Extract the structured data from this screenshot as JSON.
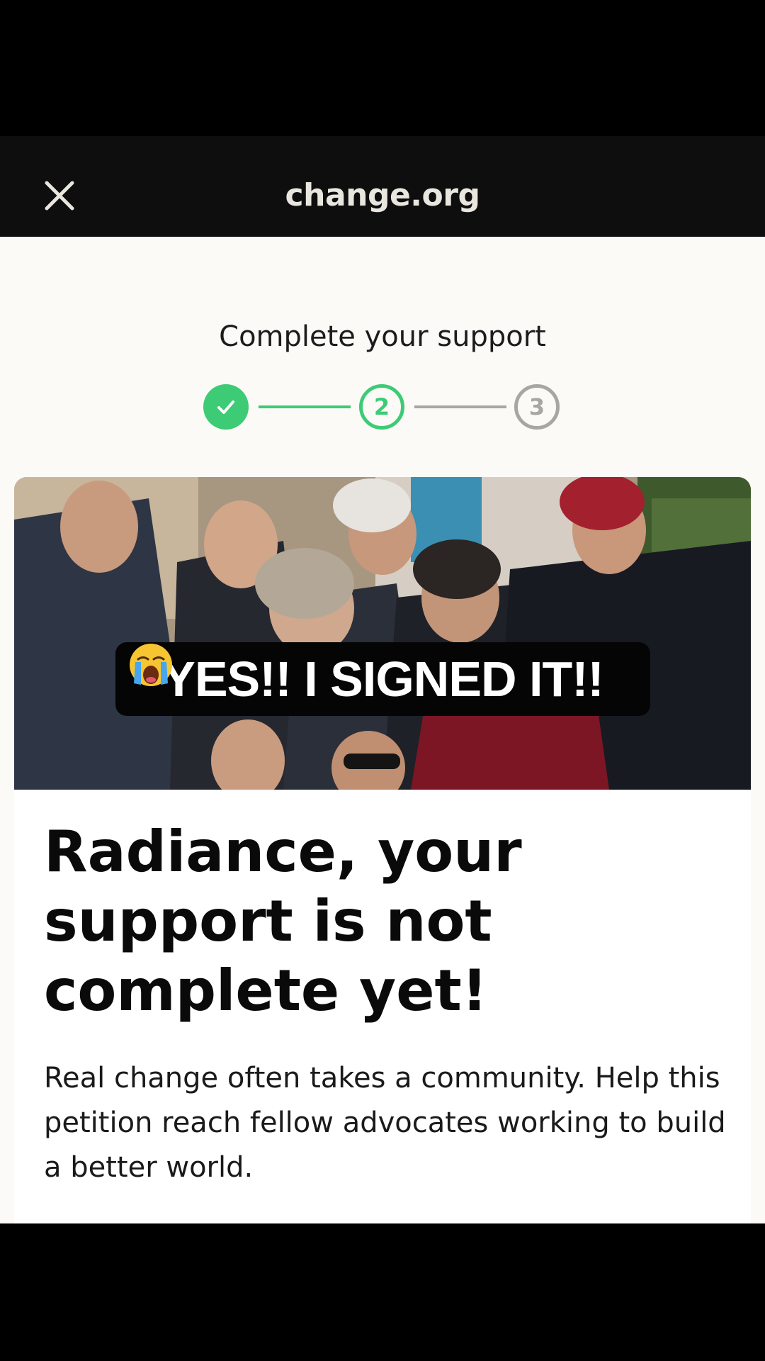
{
  "header": {
    "brand": "change.org",
    "close_icon": "close-icon"
  },
  "progress": {
    "title": "Complete your support",
    "steps": [
      {
        "label": "",
        "state": "complete",
        "icon": "check-icon"
      },
      {
        "label": "2",
        "state": "current"
      },
      {
        "label": "3",
        "state": "upcoming"
      }
    ],
    "accent_color": "#3dcb75",
    "inactive_color": "#a8a6a2"
  },
  "card": {
    "image_caption": "YES!! I SIGNED IT!!",
    "caption_emoji": "crying-face-emoji",
    "headline": "Radiance, your support is not complete yet!",
    "body": "Real change often takes a community. Help this petition reach fellow advocates working to build a better world."
  }
}
